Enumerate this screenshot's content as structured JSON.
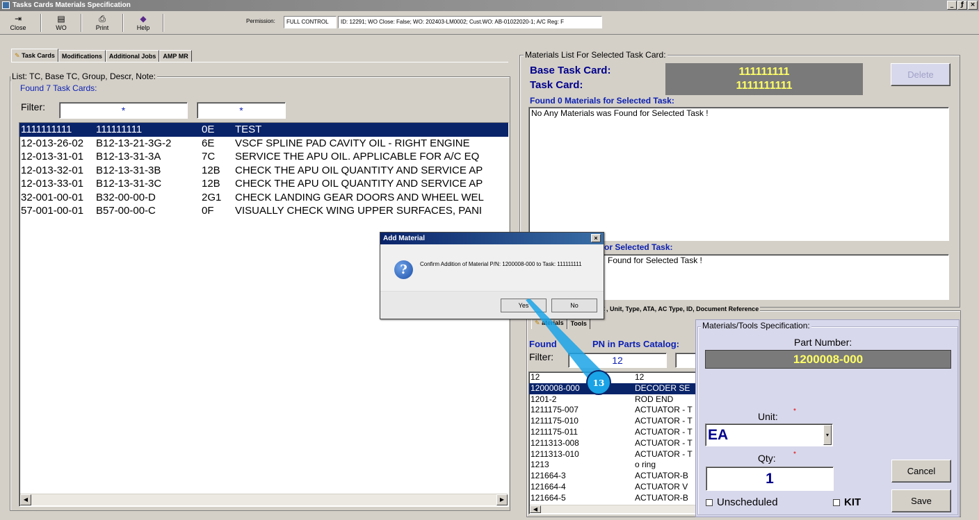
{
  "window": {
    "title": "Tasks Cards Materials Specification",
    "controls": [
      "_",
      "ƒ",
      "×"
    ]
  },
  "toolbar": {
    "buttons": [
      {
        "label": "Close",
        "icon": "door-exit-icon"
      },
      {
        "label": "WO",
        "icon": "printer-doc-icon"
      },
      {
        "label": "Print",
        "icon": "printer-icon"
      },
      {
        "label": "Help",
        "icon": "help-diamond-icon"
      }
    ],
    "permission_label": "Permission:",
    "permission_value": "FULL CONTROL",
    "info": "ID: 12291; WO Close: False; WO: 202403-LM0002; Cust.WO: AB-01022020-1; A/C Reg: F"
  },
  "tabs": [
    "Task Cards",
    "Modifications",
    "Additional Jobs",
    "AMP MR"
  ],
  "left": {
    "legend": "List: TC, Base TC, Group, Descr, Note:",
    "found": "Found 7 Task Cards:",
    "filter_label": "Filter:",
    "filter1": "*",
    "filter2": "*",
    "rows": [
      {
        "tc": "1111111111",
        "base": "111111111",
        "group": "0E",
        "descr": "TEST",
        "selected": true
      },
      {
        "tc": "12-013-26-02",
        "base": "B12-13-21-3G-2",
        "group": "6E",
        "descr": "VSCF SPLINE PAD CAVITY OIL - RIGHT ENGINE"
      },
      {
        "tc": "12-013-31-01",
        "base": "B12-13-31-3A",
        "group": "7C",
        "descr": "SERVICE THE APU OIL. APPLICABLE FOR A/C EQ"
      },
      {
        "tc": "12-013-32-01",
        "base": "B12-13-31-3B",
        "group": "12B",
        "descr": "CHECK THE APU OIL QUANTITY AND SERVICE AP"
      },
      {
        "tc": "12-013-33-01",
        "base": "B12-13-31-3C",
        "group": "12B",
        "descr": "CHECK THE APU OIL QUANTITY AND SERVICE AP"
      },
      {
        "tc": "32-001-00-01",
        "base": "B32-00-00-D",
        "group": "2G1",
        "descr": "CHECK LANDING GEAR DOORS AND WHEEL WEL"
      },
      {
        "tc": "57-001-00-01",
        "base": "B57-00-00-C",
        "group": "0F",
        "descr": "VISUALLY CHECK WING UPPER SURFACES, PANI"
      }
    ]
  },
  "right": {
    "legend": "Materials List For Selected Task Card:",
    "base_tc_label": "Base Task Card:",
    "base_tc_value": "111111111",
    "tc_label": "Task Card:",
    "tc_value": "1111111111",
    "delete_label": "Delete",
    "found_materials": "Found 0 Materials for Selected Task:",
    "no_materials": "No Any Materials was Found for Selected Task !",
    "tools_header_partial": "or Selected Task:",
    "tools_msg_partial": "Found for Selected Task !",
    "catalog_legend_partial": ", Unit, Type, ATA, AC Type, ID, Document Reference",
    "sub_tabs": [
      "aterials",
      "Tools"
    ],
    "found_pn_partial_a": "Found",
    "found_pn_partial_b": "PN in Parts Catalog:",
    "filter_label": "Filter:",
    "filter_value": "12",
    "catalog_rows": [
      {
        "pn": "12",
        "desc": "12"
      },
      {
        "pn": "1200008-000",
        "desc": "DECODER SE",
        "selected": true
      },
      {
        "pn": "1201-2",
        "desc": "ROD END"
      },
      {
        "pn": "1211175-007",
        "desc": "ACTUATOR - T"
      },
      {
        "pn": "1211175-010",
        "desc": "ACTUATOR - T"
      },
      {
        "pn": "1211175-011",
        "desc": "ACTUATOR - T"
      },
      {
        "pn": "1211313-008",
        "desc": "ACTUATOR - T"
      },
      {
        "pn": "1211313-010",
        "desc": "ACTUATOR - T"
      },
      {
        "pn": "1213",
        "desc": "o ring"
      },
      {
        "pn": "121664-3",
        "desc": "ACTUATOR-B"
      },
      {
        "pn": "121664-4",
        "desc": "ACTUATOR V"
      },
      {
        "pn": "121664-5",
        "desc": "ACTUATOR-B"
      }
    ]
  },
  "spec": {
    "legend": "Materials/Tools Specification:",
    "pn_label": "Part Number:",
    "pn_value": "1200008-000",
    "unit_label": "Unit:",
    "unit_value": "EA",
    "qty_label": "Qty:",
    "qty_value": "1",
    "required_mark": "*",
    "unscheduled_label": "Unscheduled",
    "kit_label": "KIT",
    "cancel_label": "Cancel",
    "save_label": "Save"
  },
  "dialog": {
    "title": "Add Material",
    "message": "Confirm Addition of Material P/N: 1200008-000 to Task: 111111111",
    "yes_label": "Yes",
    "no_label": "No"
  },
  "annotation": {
    "step": "13",
    "color": "#1aa3e6"
  },
  "colors": {
    "selection": "#0a246a",
    "label_blue": "#0b1fb2",
    "tc_value_yellow": "#ffff66",
    "tc_box_gray": "#7a7a7a"
  }
}
